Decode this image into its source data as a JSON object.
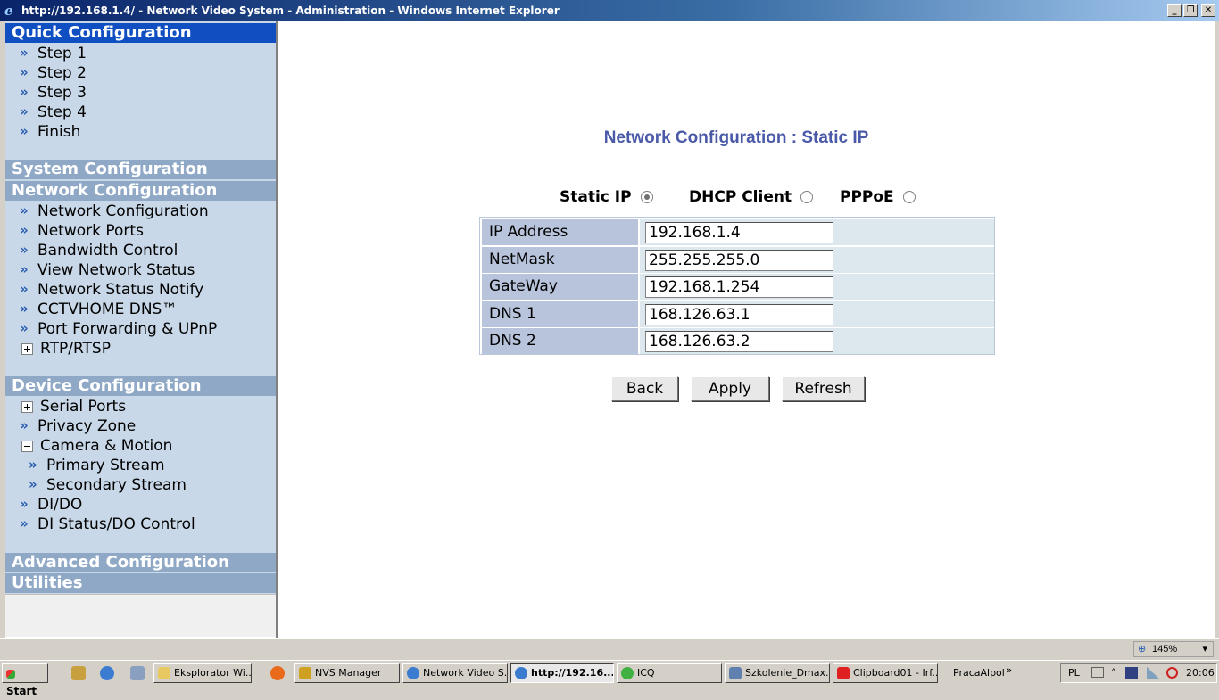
{
  "window": {
    "title": "http://192.168.1.4/ - Network Video System - Administration - Windows Internet Explorer",
    "min": "_",
    "restore": "❐",
    "close": "✕"
  },
  "menu": {
    "quick": {
      "header": "Quick Configuration",
      "items": [
        "Step 1",
        "Step 2",
        "Step 3",
        "Step 4",
        "Finish"
      ]
    },
    "system_header": "System Configuration",
    "network": {
      "header": "Network Configuration",
      "items": [
        "Network Configuration",
        "Network Ports",
        "Bandwidth Control",
        "View Network Status",
        "Network Status Notify",
        "CCTVHOME DNS™",
        "Port Forwarding & UPnP"
      ],
      "expandable": "RTP/RTSP"
    },
    "device": {
      "header": "Device Configuration",
      "serial": "Serial Ports",
      "privacy": "Privacy Zone",
      "camera": "Camera & Motion",
      "primary": "Primary Stream",
      "secondary": "Secondary Stream",
      "dido": "DI/DO",
      "distatus": "DI Status/DO Control"
    },
    "advanced_header": "Advanced Configuration",
    "utilities_header": "Utilities"
  },
  "main": {
    "heading": "Network Configuration : Static IP",
    "modes": {
      "static": "Static IP",
      "dhcp": "DHCP Client",
      "pppoe": "PPPoE",
      "selected": "Static IP"
    },
    "fields": {
      "ip_label": "IP Address",
      "ip_value": "192.168.1.4",
      "mask_label": "NetMask",
      "mask_value": "255.255.255.0",
      "gw_label": "GateWay",
      "gw_value": "192.168.1.254",
      "dns1_label": "DNS 1",
      "dns1_value": "168.126.63.1",
      "dns2_label": "DNS 2",
      "dns2_value": "168.126.63.2"
    },
    "buttons": {
      "back": "Back",
      "apply": "Apply",
      "refresh": "Refresh"
    }
  },
  "statusbar": {
    "zoom": "145%"
  },
  "taskbar": {
    "start": "Start",
    "items": [
      "Eksplorator Wi...",
      "NVS Manager",
      "Network Video S...",
      "http://192.16...",
      "ICQ",
      "Szkolenie_Dmax...",
      "Clipboard01 - Irf..."
    ],
    "toolbar_label": "PracaAlpol",
    "language": "PL",
    "clock": "20:06"
  }
}
